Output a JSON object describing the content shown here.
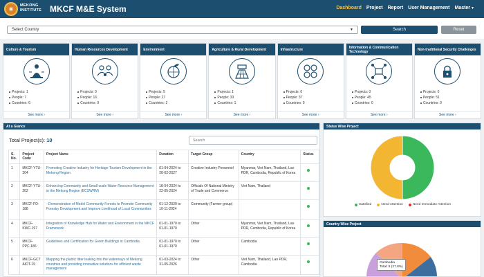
{
  "header": {
    "logo_line1": "MEKONG",
    "logo_line2": "INSTITUTE",
    "title": "MKCF M&E System",
    "nav": [
      {
        "label": "Dashboard",
        "active": true
      },
      {
        "label": "Project",
        "active": false
      },
      {
        "label": "Report",
        "active": false
      },
      {
        "label": "User Management",
        "active": false
      },
      {
        "label": "Master",
        "active": false,
        "dropdown": true
      }
    ]
  },
  "search": {
    "select_value": "Select Country",
    "search_label": "Search",
    "reset_label": "Reset"
  },
  "categories": [
    {
      "title": "Culture & Tourism",
      "icon": "buddha-icon",
      "projects": "Projects: 1",
      "people": "People: 7",
      "countries": "Countries: 6",
      "more": "See more"
    },
    {
      "title": "Human Resources Development",
      "icon": "people-group-icon",
      "projects": "Projects: 0",
      "people": "People: 16",
      "countries": "Countries: 0",
      "more": "See more"
    },
    {
      "title": "Environment",
      "icon": "globe-leaf-icon",
      "projects": "Projects: 5",
      "people": "People: 27",
      "countries": "Countries: 2",
      "more": "See more"
    },
    {
      "title": "Agriculture & Rural Development",
      "icon": "farm-field-icon",
      "projects": "Projects: 1",
      "people": "People: 33",
      "countries": "Countries: 1",
      "more": "See more"
    },
    {
      "title": "Infrastructure",
      "icon": "infrastructure-icon",
      "projects": "Projects: 0",
      "people": "People: 37",
      "countries": "Countries: 0",
      "more": "See more"
    },
    {
      "title": "Information & Communication Technology",
      "icon": "network-icon",
      "projects": "Projects: 0",
      "people": "People: 45",
      "countries": "Countries: 0",
      "more": "See more"
    },
    {
      "title": "Non-traditional Security Challenges",
      "icon": "security-lock-icon",
      "projects": "Projects: 0",
      "people": "People: 51",
      "countries": "Countries: 0",
      "more": "See more"
    }
  ],
  "glance": {
    "panel_title": "At a Glance",
    "total_label": "Total Project(s): ",
    "total_value": "10",
    "search_placeholder": "Search",
    "columns": [
      "S. No.",
      "Project Code",
      "Project Name",
      "Duration",
      "Target Group",
      "Country",
      "Status"
    ],
    "rows": [
      {
        "no": "1",
        "code": "MKCF-YTU-204",
        "name": "Promoting Creative Industry for Heritage Tourism Development in the Mekong Region",
        "duration": "01-04-2024 to 28-02-2027",
        "target": "Creative Industry Personnel",
        "country": "Myanmar, Viet Nam, Thailand, Lao PDR, Cambodia, Republic of Korea"
      },
      {
        "no": "2",
        "code": "MKCF-YTU-202",
        "name": "Enhancing Community and Small-scale Water Resource Management in the Mekong Region (ECSWRM)",
        "duration": "18-04-2024 to 22-05-2024",
        "target": "Officials Of National Ministry of Trade and Commerce",
        "country": "Viet Nam, Thailand"
      },
      {
        "no": "3",
        "code": "MKCF-FD-188",
        "name": "- Demonstration of Model Community Forests to Promote Community Forestry Development and Improve Livelihood of Local Communities",
        "duration": "01-12-2020 to 10-11-2024",
        "target": "Community (Farmer group)",
        "country": ""
      },
      {
        "no": "4",
        "code": "MKCF-KWC-197",
        "name": "Integration of Knowledge Hub for Water and Environment in the MKCF Framework",
        "duration": "01-01-1970 to 01-01-1970",
        "target": "Other",
        "country": "Myanmar, Viet Nam, Thailand, Lao PDR, Cambodia, Republic of Korea"
      },
      {
        "no": "5",
        "code": "MKCF-PPC-186",
        "name": "Guidelines and Certification for Green Buildings in Cambodia.",
        "duration": "01-01-1970 to 01-01-1970",
        "target": "Other",
        "country": "Cambodia"
      },
      {
        "no": "6",
        "code": "MKCF-GCT AIOT-19",
        "name": "Mapping the plastic litter leaking into the waterways of Mekong countries and providing innovative solutions for efficient waste management",
        "duration": "01-03-2024 to 31-05-2026",
        "target": "Other",
        "country": "Viet Nam, Thailand, Lao PDR, Cambodia"
      }
    ]
  },
  "status_panel": {
    "title": "Status Wise Project",
    "legend": [
      {
        "label": "Satisfied",
        "color": "#3cb85c"
      },
      {
        "label": "Need Attention",
        "color": "#f2b632"
      },
      {
        "label": "Need Immediate Attention",
        "color": "#e03131"
      }
    ]
  },
  "country_panel": {
    "title": "Country Wise Project",
    "tooltip_country": "Cambodia",
    "tooltip_value": "Total: 5 (27.8%)"
  },
  "chart_data": [
    {
      "type": "pie",
      "title": "Status Wise Project",
      "categories": [
        "Satisfied",
        "Need Attention",
        "Need Immediate Attention"
      ],
      "values": [
        50,
        50,
        0
      ],
      "colors": [
        "#3cb85c",
        "#f2b632",
        "#e03131"
      ],
      "legend": "bottom"
    },
    {
      "type": "pie",
      "title": "Country Wise Project",
      "categories": [
        "Cambodia"
      ],
      "values": [
        5
      ],
      "annotations": [
        "Cambodia Total: 5 (27.8%)"
      ]
    }
  ]
}
